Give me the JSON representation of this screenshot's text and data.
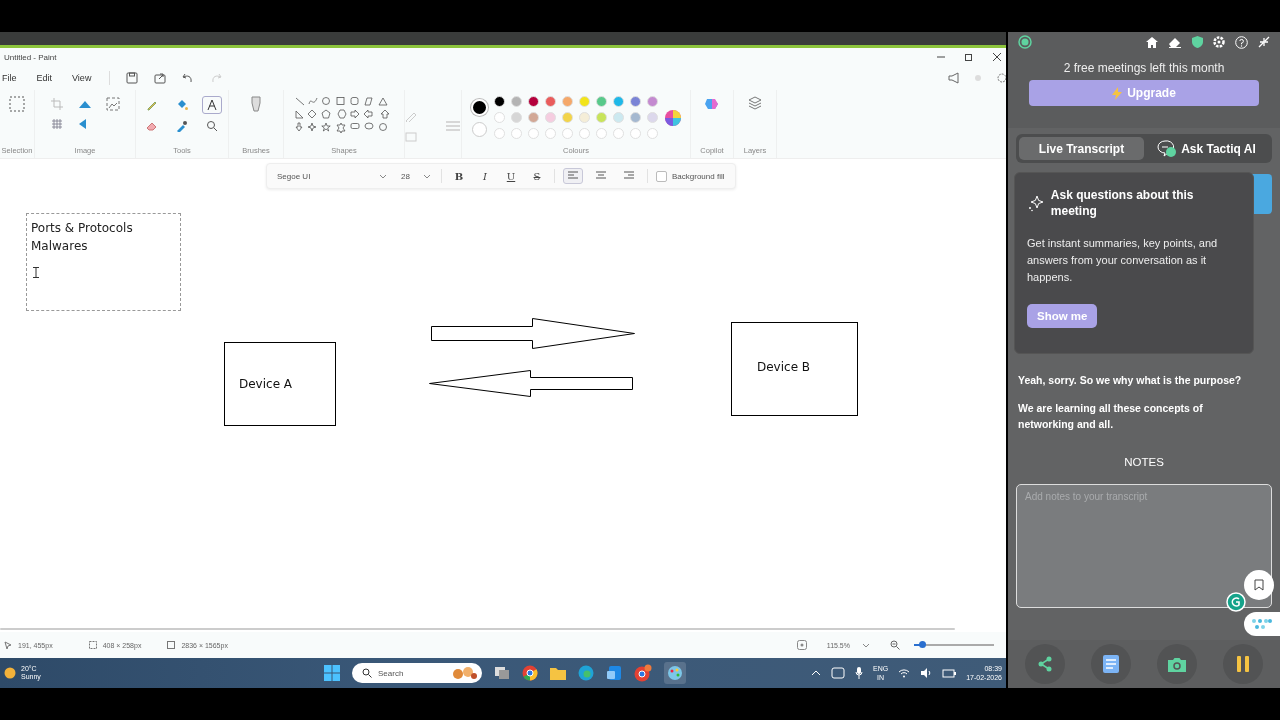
{
  "paint": {
    "title": "Untitled - Paint",
    "menu": [
      "File",
      "Edit",
      "View"
    ],
    "ribbon_groups": [
      "Selection",
      "Image",
      "Tools",
      "Brushes",
      "Shapes",
      "Colours",
      "Copilot",
      "Layers"
    ],
    "palette": [
      [
        {
          "color": "#000000"
        },
        {
          "color": "#b4b4b4"
        },
        {
          "color": "#b4003c"
        },
        {
          "color": "#e95c5c"
        },
        {
          "color": "#f5a86a"
        },
        {
          "color": "#f2e41a"
        },
        {
          "color": "#58c98a"
        },
        {
          "color": "#1fb8e8"
        },
        {
          "color": "#7a84d6"
        },
        {
          "color": "#c48ad0"
        }
      ],
      [
        {
          "color": "#ffffff"
        },
        {
          "color": "#d6d6d6"
        },
        {
          "color": "#d2a896"
        },
        {
          "color": "#f5cde0"
        },
        {
          "color": "#f2d44a"
        },
        {
          "color": "#f5eed8"
        },
        {
          "color": "#c8e45a"
        },
        {
          "color": "#cce9f0"
        },
        {
          "color": "#a4b8d0"
        },
        {
          "color": "#dcd8ec"
        }
      ]
    ],
    "text_toolbar": {
      "font": "Segoe UI",
      "size": "28",
      "styles": [
        {
          "label": "B",
          "kind": "bold"
        },
        {
          "label": "I",
          "kind": "italic"
        },
        {
          "label": "U",
          "kind": "underline"
        },
        {
          "label": "S",
          "kind": "strike"
        }
      ],
      "align": [
        {
          "kind": "left",
          "selected": true
        },
        {
          "kind": "center",
          "selected": false
        },
        {
          "kind": "right",
          "selected": false
        }
      ],
      "background_fill": {
        "label": "Background fill",
        "checked": false
      }
    },
    "canvas": {
      "text_box": [
        "Ports & Protocols",
        "Malwares"
      ],
      "devices": [
        "Device A",
        "Device B"
      ]
    },
    "status": {
      "cursor": "191, 455px",
      "selection": "408 × 258px",
      "canvas_size": "2836 × 1565px",
      "zoom": "115.5%",
      "zoom_level": {
        "level": 0.1
      }
    }
  },
  "taskbar": {
    "temperature": "20°C",
    "weather": "Sunny",
    "search": "Search",
    "language": "ENG",
    "region": "IN",
    "time": "08:39",
    "date": "17-02-2026"
  },
  "tactiq": {
    "meetings_left": "2 free meetings left this month",
    "upgrade": "Upgrade",
    "tabs": [
      {
        "label": "Live Transcript",
        "selected": true
      },
      {
        "label": "Ask Tactiq AI",
        "selected": false
      }
    ],
    "popover": {
      "title": "Ask questions about this meeting",
      "body": "Get instant summaries, key points, and answers from your conversation as it happens.",
      "button": "Show me"
    },
    "transcript": [
      "Yeah, sorry. So we why what is the purpose?",
      "We are learning all these concepts of networking and all."
    ],
    "notes_heading": "NOTES",
    "notes": {
      "placeholder": "Add notes to your transcript"
    }
  }
}
